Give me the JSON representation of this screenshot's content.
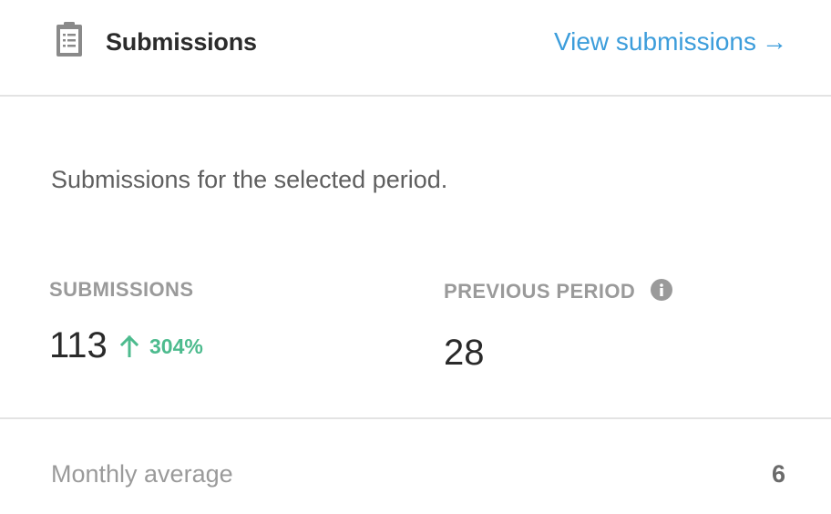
{
  "header": {
    "title": "Submissions",
    "link_label": "View submissions",
    "link_arrow": "→"
  },
  "description": "Submissions for the selected period.",
  "stats": {
    "submissions": {
      "label": "SUBMISSIONS",
      "value": "113",
      "change": "304%",
      "change_direction": "up"
    },
    "previous": {
      "label": "PREVIOUS PERIOD",
      "value": "28"
    }
  },
  "footer": {
    "monthly_average_label": "Monthly average",
    "monthly_average_value": "6"
  },
  "colors": {
    "link": "#3c9ddb",
    "positive_change": "#4dbb8e",
    "divider": "#e3e3e3",
    "icon": "#8a8a8a"
  },
  "icons": [
    "clipboard-icon",
    "arrow-right-icon",
    "info-icon",
    "arrow-up-icon"
  ]
}
